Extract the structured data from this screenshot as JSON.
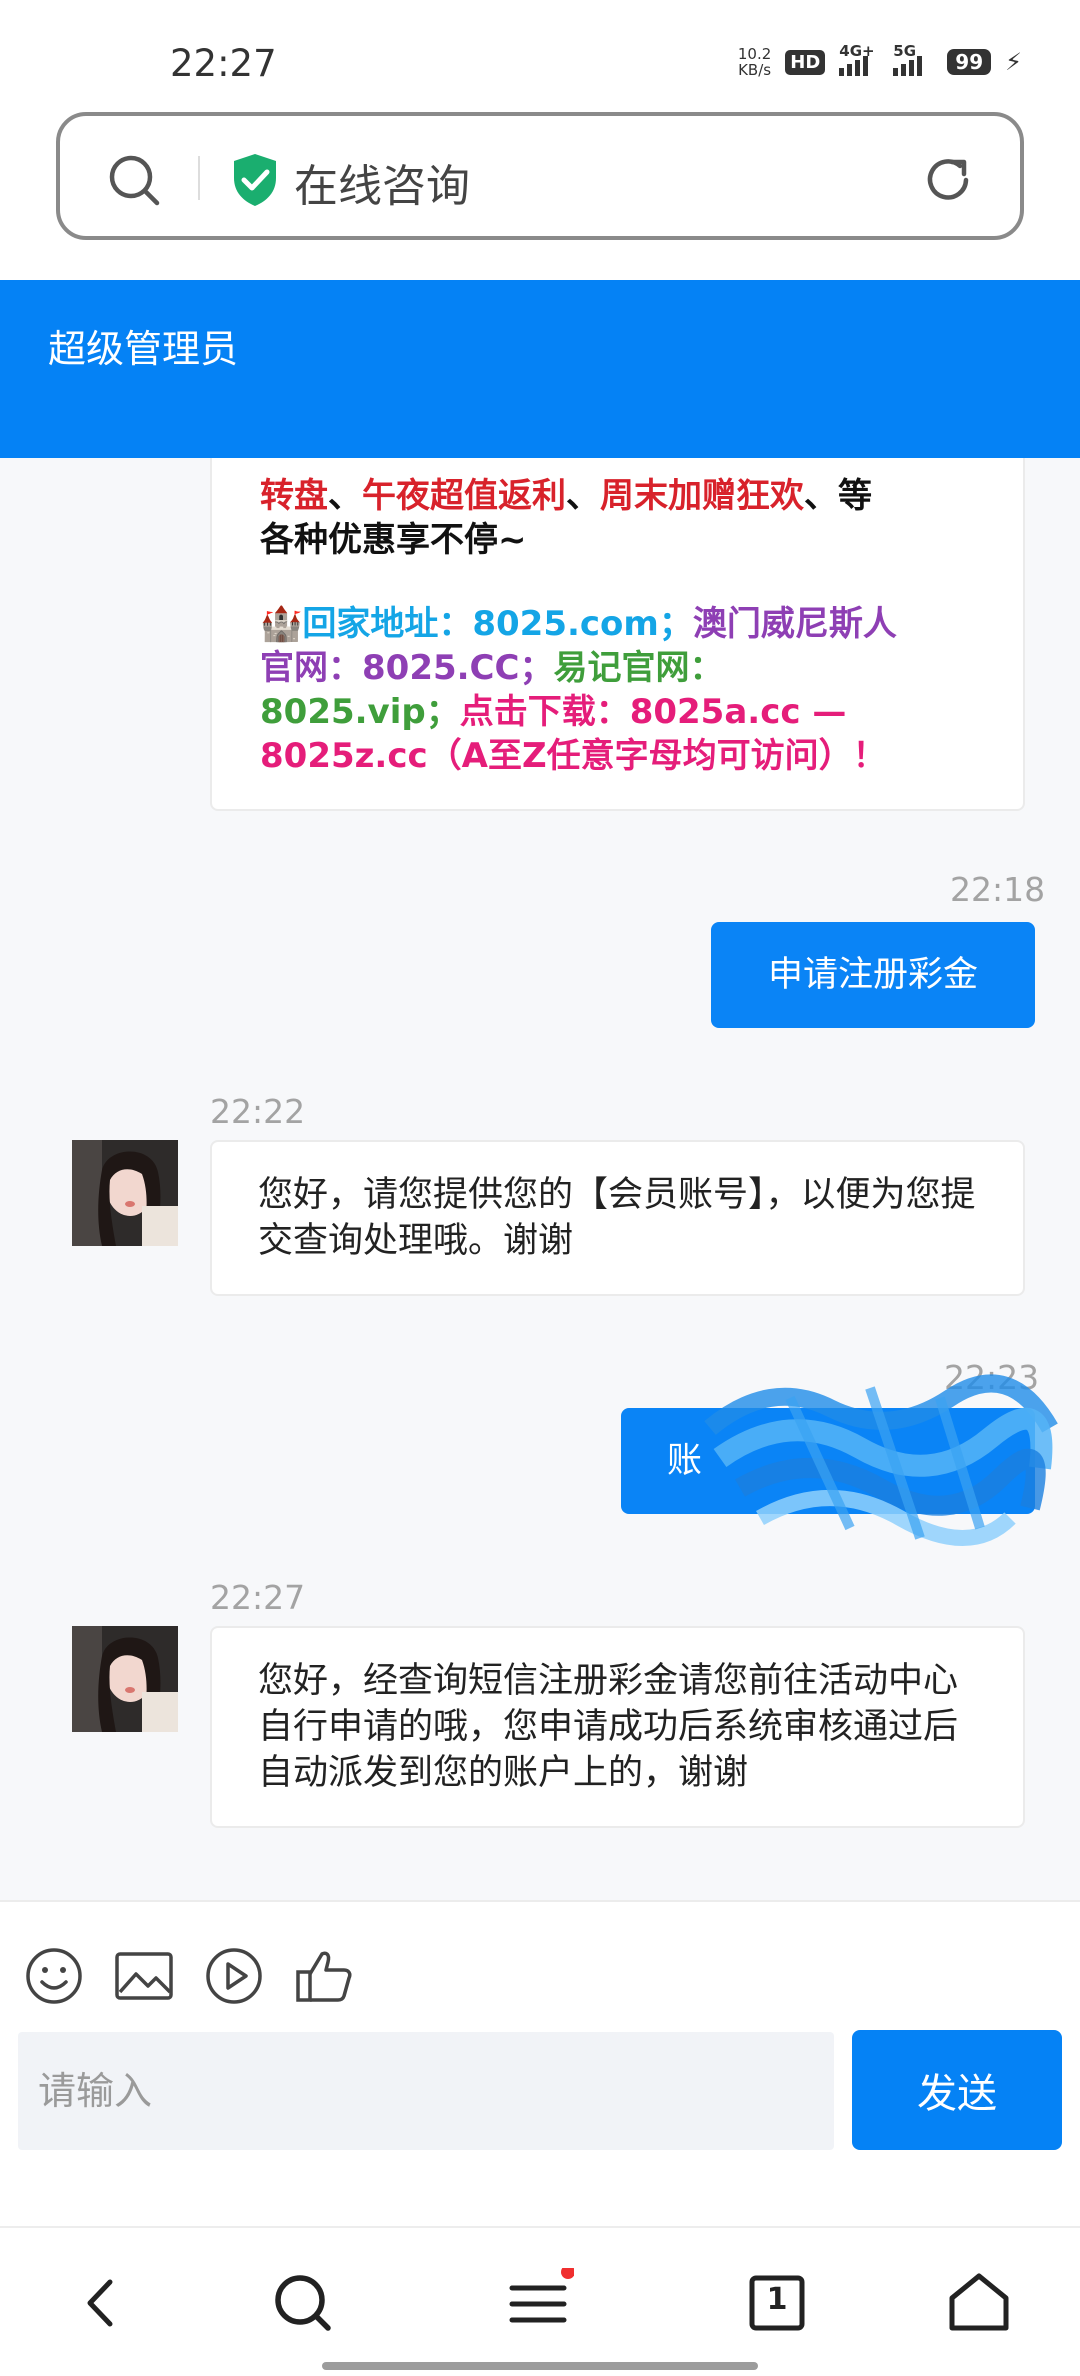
{
  "status_bar": {
    "time": "22:27",
    "net_speed_value": "10.2",
    "net_speed_unit": "KB/s",
    "hd_label": "HD",
    "sim1_label": "4G+",
    "sim2_label": "5G",
    "battery": "99"
  },
  "url_bar": {
    "title": "在线咨询"
  },
  "header": {
    "title": "超级管理员"
  },
  "messages": {
    "promo": {
      "line1_a": "转盘",
      "line1_sep1": "、",
      "line1_b": "午夜超值返利",
      "line1_sep2": "、",
      "line1_c": "周末加赠狂欢",
      "line1_sep3": "、等",
      "line2": "各种优惠享不停~",
      "castle_emoji": "🏰",
      "addr_label": "回家地址：",
      "addr_value": "8025.com；",
      "macau_label": "澳门威尼斯人",
      "macau_line2": "官网：8025.CC；",
      "yiji_label": "易记官网：",
      "yiji_value": "8025.vip；",
      "download_label": "点击下载：",
      "download_value": "8025a.cc —",
      "download_line2": "8025z.cc（A至Z任意字母均可访问）！"
    },
    "out1": {
      "time": "22:18",
      "text": "申请注册彩金"
    },
    "in1": {
      "time": "22:22",
      "text": "您好，请您提供您的【会员账号】，以便为您提交查询处理哦。谢谢"
    },
    "out2": {
      "time": "22:23",
      "text": "账"
    },
    "in2": {
      "time": "22:27",
      "text": "您好，经查询短信注册彩金请您前往活动中心自行申请的哦，您申请成功后系统审核通过后自动派发到您的账户上的，谢谢"
    }
  },
  "input": {
    "placeholder": "请输入",
    "send_label": "发送"
  },
  "bottom_nav": {
    "tabs_count": "1"
  },
  "colors": {
    "header_blue": "#0582f5",
    "bubble_blue": "#0a84f6",
    "shield_green": "#1aae6f"
  }
}
